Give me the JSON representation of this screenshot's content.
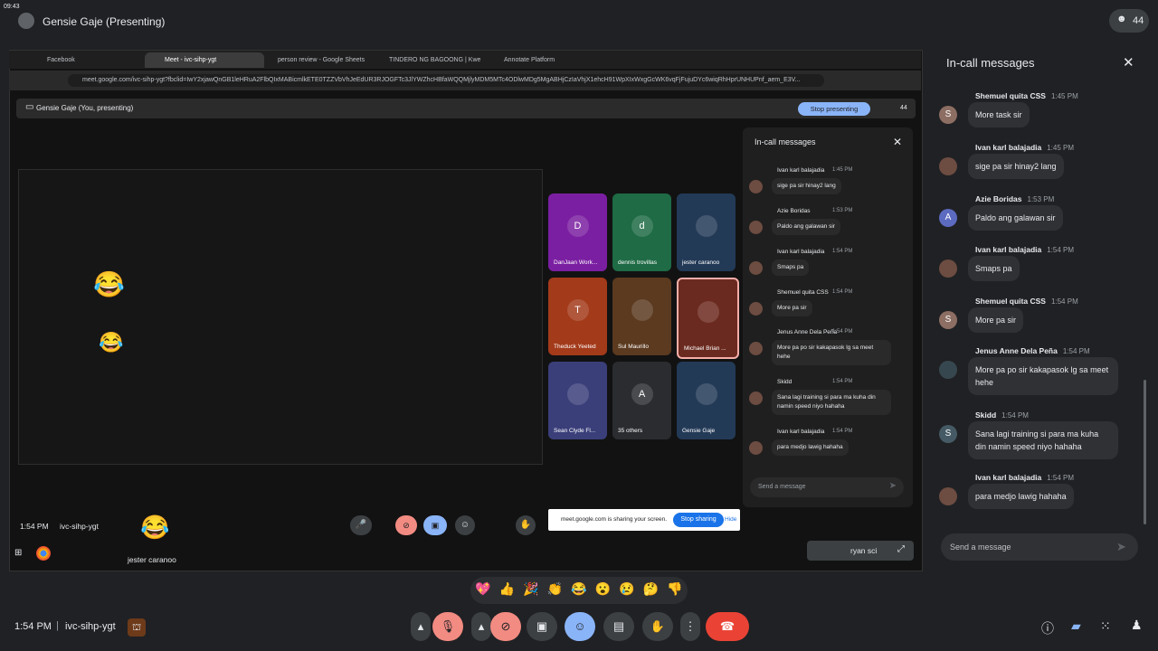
{
  "clock": "09:43",
  "topbar": {
    "presenter": "Gensie Gaje (Presenting)",
    "people_count": "44"
  },
  "browser": {
    "tabs": [
      "Facebook",
      "Meet - ivc-sihp-ygt",
      "person review - Google Sheets",
      "TINDERO NG BAGOONG | Kwe",
      "Annotate Platform"
    ],
    "url": "meet.google.com/ivc-sihp-ygt?fbclid=IwY2xjawQnGB1leHRuA2FlbQIxMABicmlkETE0TZZVbVhJeEdUR3RJOGFTc3JlYWZhcHBfaWQQMjlyMDM5MTc4ODlwMDg5MgABHjCzIaVhjX1ehcH91WpXIxWxgGcWK6vqFjFujuDYc6wiqRhHprUNHUPnf_aem_E3V..."
  },
  "presenting_bar": {
    "label": "Gensie Gaje (You, presenting)",
    "stop_label": "Stop presenting",
    "count": "44"
  },
  "tiles": [
    {
      "name": "DanJaan Work...",
      "initial": "D",
      "color": "#7b1fa2"
    },
    {
      "name": "dennis trovillas",
      "initial": "d",
      "color": "#1e6b45"
    },
    {
      "name": "jester caranoo",
      "initial": "",
      "color": "#233a57"
    },
    {
      "name": "Theduck Yeeted",
      "initial": "T",
      "color": "#a33a1a"
    },
    {
      "name": "Sul Maurillo",
      "initial": "",
      "color": "#5b3a1f"
    },
    {
      "name": "Michael Brian ...",
      "initial": "",
      "color": "#6b2a1f"
    },
    {
      "name": "Sean Clyde Fl...",
      "initial": "",
      "color": "#3a3f7a"
    },
    {
      "name": "35 others",
      "initial": "A",
      "color": "#2a2c30"
    },
    {
      "name": "Gensie Gaje",
      "initial": "",
      "color": "#233a57"
    }
  ],
  "inner_chat": {
    "title": "In-call messages",
    "placeholder": "Send a message",
    "messages": [
      {
        "name": "Ivan karl balajadia",
        "time": "1:45 PM",
        "text": "sige pa sir hinay2 lang"
      },
      {
        "name": "Azie Boridas",
        "time": "1:53 PM",
        "text": "Paldo ang galawan sir"
      },
      {
        "name": "Ivan karl balajadia",
        "time": "1:54 PM",
        "text": "Smaps pa"
      },
      {
        "name": "Shemuel quita CSS",
        "time": "1:54 PM",
        "text": "More pa sir"
      },
      {
        "name": "Jenus Anne Dela Peña",
        "time": "1:54 PM",
        "text": "More pa po sir kakapasok lg sa meet hehe"
      },
      {
        "name": "Skidd",
        "time": "1:54 PM",
        "text": "Sana lagi training si para ma kuha din namin speed niyo hahaha"
      },
      {
        "name": "Ivan karl balajadia",
        "time": "1:54 PM",
        "text": "para medjo lawig hahaha"
      }
    ]
  },
  "sharing_notice": {
    "text": "meet.google.com is sharing your screen.",
    "stop": "Stop sharing",
    "hide": "Hide"
  },
  "inner_bottom": {
    "time": "1:54 PM",
    "code": "ivc-sihp-ygt",
    "speaker": "jester caranoo",
    "pinned_name": "ryan sci"
  },
  "chat": {
    "title": "In-call messages",
    "placeholder": "Send a message",
    "messages": [
      {
        "name": "Shemuel quita CSS",
        "time": "1:45 PM",
        "text": "More task sir",
        "initial": "S",
        "color": "#8d6e63"
      },
      {
        "name": "Ivan karl balajadia",
        "time": "1:45 PM",
        "text": "sige pa sir hinay2 lang",
        "initial": "",
        "color": "#6d4c41"
      },
      {
        "name": "Azie Boridas",
        "time": "1:53 PM",
        "text": "Paldo ang galawan sir",
        "initial": "A",
        "color": "#5c6bc0"
      },
      {
        "name": "Ivan karl balajadia",
        "time": "1:54 PM",
        "text": "Smaps pa",
        "initial": "",
        "color": "#6d4c41"
      },
      {
        "name": "Shemuel quita CSS",
        "time": "1:54 PM",
        "text": "More pa sir",
        "initial": "S",
        "color": "#8d6e63"
      },
      {
        "name": "Jenus Anne Dela Peña",
        "time": "1:54 PM",
        "text": "More pa po sir kakapasok lg sa meet hehe",
        "initial": "",
        "color": "#37474f"
      },
      {
        "name": "Skidd",
        "time": "1:54 PM",
        "text": "Sana lagi training si para ma kuha din namin speed niyo hahaha",
        "initial": "S",
        "color": "#455a64"
      },
      {
        "name": "Ivan karl balajadia",
        "time": "1:54 PM",
        "text": "para medjo lawig hahaha",
        "initial": "",
        "color": "#6d4c41"
      }
    ]
  },
  "bottom": {
    "time": "1:54 PM",
    "separator": "|",
    "code": "ivc-sihp-ygt"
  },
  "reactions": [
    "💖",
    "👍",
    "🎉",
    "👏",
    "😂",
    "😮",
    "😢",
    "🤔",
    "👎"
  ]
}
